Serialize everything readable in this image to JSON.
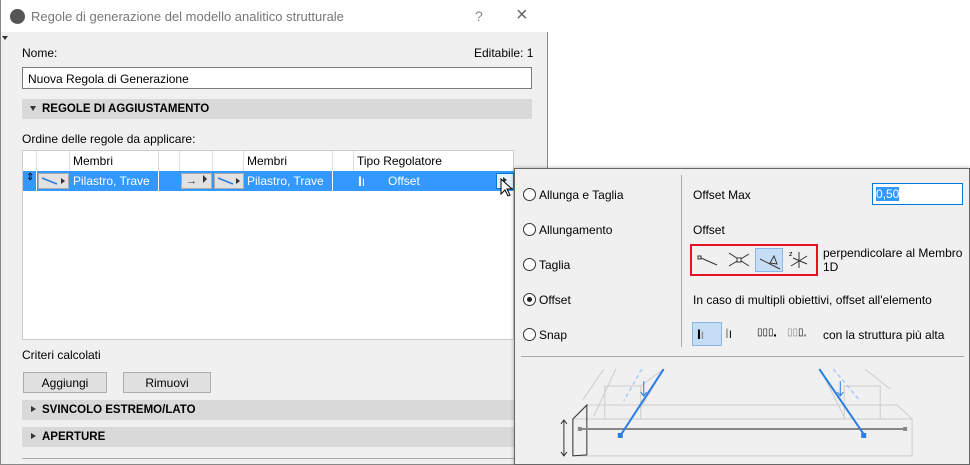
{
  "dialog": {
    "title": "Regole di generazione del modello analitico strutturale",
    "help": "?",
    "close": "×",
    "name_label": "Nome:",
    "editable_label": "Editabile: 1",
    "name_value": "Nuova Regola di Generazione",
    "section_adjust": "REGOLE DI AGGIUSTAMENTO",
    "order_label": "Ordine delle regole da applicare:",
    "table": {
      "headers": [
        "Membri",
        "Membri",
        "Tipo Regolatore"
      ],
      "row": {
        "members1": "Pilastro, Trave",
        "members2": "Pilastro, Trave",
        "adjuster": "Offset"
      }
    },
    "criteria_label": "Criteri calcolati",
    "add": "Aggiungi",
    "remove": "Rimuovi",
    "section_release": "SVINCOLO ESTREMO/LATO",
    "section_openings": "APERTURE"
  },
  "popup": {
    "options": [
      "Allunga e Taglia",
      "Allungamento",
      "Taglia",
      "Offset",
      "Snap"
    ],
    "selected": "Offset",
    "offset_max_label": "Offset Max",
    "offset_max_value": "0,50",
    "offset_label": "Offset",
    "perp_label": "perpendicolare al Membro 1D",
    "multi_label": "In caso di multipli obiettivi, offset all'elemento",
    "highest_label": "con la struttura più alta"
  },
  "colors": {
    "selection": "#3399ff",
    "highlight": "#e81123",
    "beam": "#2a7de1"
  }
}
